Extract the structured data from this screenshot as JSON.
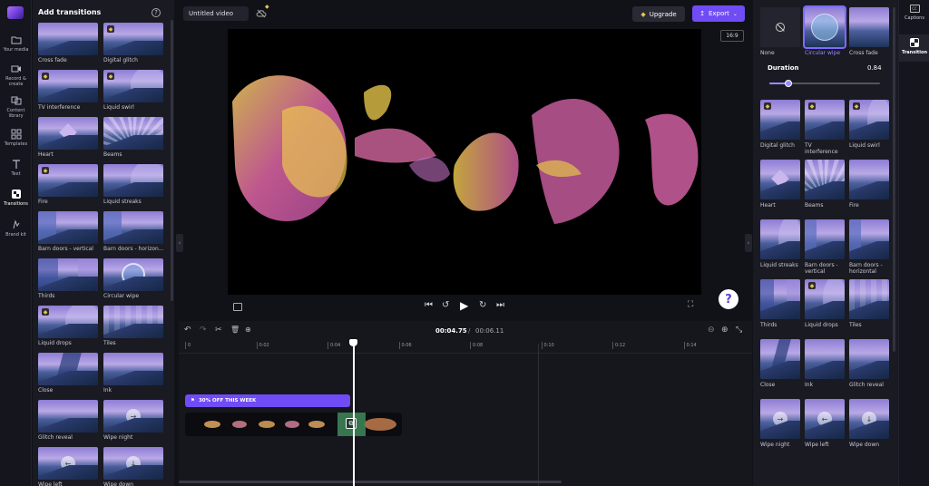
{
  "rail": [
    {
      "label": "Your media",
      "icon": "folder-icon"
    },
    {
      "label": "Record & create",
      "icon": "camera-icon"
    },
    {
      "label": "Content library",
      "icon": "library-icon"
    },
    {
      "label": "Templates",
      "icon": "templates-icon"
    },
    {
      "label": "Text",
      "icon": "text-icon"
    },
    {
      "label": "Transitions",
      "icon": "transitions-icon"
    },
    {
      "label": "Brand kit",
      "icon": "brand-kit-icon"
    }
  ],
  "transitions_panel": {
    "title": "Add transitions",
    "items": [
      {
        "label": "Cross fade",
        "premium": false
      },
      {
        "label": "Digital glitch",
        "premium": true
      },
      {
        "label": "TV interference",
        "premium": true
      },
      {
        "label": "Liquid swirl",
        "premium": true
      },
      {
        "label": "Heart",
        "premium": false
      },
      {
        "label": "Beams",
        "premium": false
      },
      {
        "label": "Fire",
        "premium": true
      },
      {
        "label": "Liquid streaks",
        "premium": false
      },
      {
        "label": "Barn doors - vertical",
        "premium": false
      },
      {
        "label": "Barn doors - horizon...",
        "premium": false
      },
      {
        "label": "Thirds",
        "premium": false
      },
      {
        "label": "Circular wipe",
        "premium": false
      },
      {
        "label": "Liquid drops",
        "premium": true
      },
      {
        "label": "Tiles",
        "premium": false
      },
      {
        "label": "Close",
        "premium": false
      },
      {
        "label": "Ink",
        "premium": false
      },
      {
        "label": "Glitch reveal",
        "premium": false
      },
      {
        "label": "Wipe night",
        "premium": false
      },
      {
        "label": "Wipe left",
        "premium": false
      },
      {
        "label": "Wipe down",
        "premium": false
      }
    ]
  },
  "topbar": {
    "video_title": "Untitled video",
    "upgrade_label": "Upgrade",
    "export_label": "Export",
    "aspect_ratio": "16:9"
  },
  "timeline": {
    "current_time": "00:04.75",
    "total_time": "00:06.11",
    "ticks": [
      "0",
      "0:02",
      "0:04",
      "0:06",
      "0:08",
      "0:10",
      "0:12",
      "0:14"
    ],
    "promo_label": "30% OFF THIS WEEK"
  },
  "right_panel": {
    "duration_label": "Duration",
    "duration_value": "0.84",
    "duration_fraction": 0.17,
    "top": [
      {
        "label": "None"
      },
      {
        "label": "Circular wipe"
      },
      {
        "label": "Cross fade"
      }
    ],
    "items": [
      {
        "label": "Digital glitch",
        "premium": true
      },
      {
        "label": "TV interference",
        "premium": true
      },
      {
        "label": "Liquid swirl",
        "premium": true
      },
      {
        "label": "Heart",
        "premium": false
      },
      {
        "label": "Beams",
        "premium": false
      },
      {
        "label": "Fire",
        "premium": false
      },
      {
        "label": "Liquid streaks",
        "premium": false
      },
      {
        "label": "Barn doors - vertical",
        "premium": false
      },
      {
        "label": "Barn doors - horizontal",
        "premium": false
      },
      {
        "label": "Thirds",
        "premium": false
      },
      {
        "label": "Liquid drops",
        "premium": true
      },
      {
        "label": "Tiles",
        "premium": false
      },
      {
        "label": "Close",
        "premium": false
      },
      {
        "label": "Ink",
        "premium": false
      },
      {
        "label": "Glitch reveal",
        "premium": false
      },
      {
        "label": "Wipe night",
        "premium": false
      },
      {
        "label": "Wipe left",
        "premium": false
      },
      {
        "label": "Wipe down",
        "premium": false
      }
    ]
  },
  "right_rail": [
    {
      "label": "Captions",
      "icon": "captions-icon"
    },
    {
      "label": "Transition",
      "icon": "transition-icon"
    }
  ],
  "colors": {
    "accent": "#6f4cf5",
    "premium": "#e8c14b",
    "background": "#111118",
    "panel": "#1a1a22"
  }
}
